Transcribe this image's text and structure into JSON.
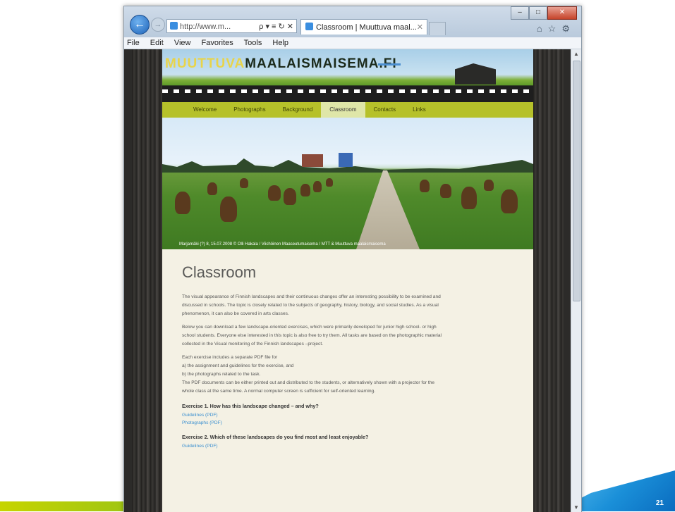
{
  "slide": {
    "page_number": "21"
  },
  "browser": {
    "address_url": "http://www.m...",
    "address_tools": "ρ ▾ ≡ ↻ ✕",
    "tab_title": "Classroom | Muuttuva maal...",
    "tab_close": "✕",
    "window_buttons": {
      "minimize": "–",
      "maximize": "□",
      "close": "✕"
    },
    "toolbar_icons": "⌂☆⚙",
    "menu": [
      "File",
      "Edit",
      "View",
      "Favorites",
      "Tools",
      "Help"
    ]
  },
  "site": {
    "logo_part1": "MUUTTUVA",
    "logo_part2": "MAALAISMAISEMA.FI",
    "nav": [
      "Welcome",
      "Photographs",
      "Background",
      "Classroom",
      "Contacts",
      "Links"
    ],
    "active_nav": "Classroom",
    "hero_caption": "Marjamäki (?) 8, 15.07.2008 © Olli Hakala / Viichöinen Maaseutumaisema / MTT & Muuttuva maalaismaisema",
    "page_title": "Classroom",
    "paragraphs": [
      "The visual appearance of Finnish landscapes and their continuous changes offer an interesting possibility to be examined and discussed in schools. The topic is closely related to the subjects of geography, history, biology, and social studies. As a visual phenomenon, it can also be covered in arts classes.",
      "Below you can download a few landscape-oriented exercises, which were primarily developed for junior high school- or high school students. Everyone else interested in this topic is also free to try them. All tasks are based on the photographic material collected in the Visual monitoring of the Finnish landscapes –project.",
      "Each exercise includes a separate PDF file for",
      "a) the assignment and guidelines for the exercise, and",
      "b) the photographs related to the task.",
      "The PDF documents can be either printed out and distributed to the students, or alternatively shown with a projector for the whole class at the same time. A normal computer screen is sufficient for self-oriented learning."
    ],
    "exercises": [
      {
        "title": "Exercise 1. How has this landscape changed – and why?",
        "links": [
          "Guidelines (PDF)",
          "Photographs (PDF)"
        ]
      },
      {
        "title": "Exercise 2. Which of these landscapes do you find most and least enjoyable?",
        "links": [
          "Guidelines (PDF)"
        ]
      }
    ]
  }
}
